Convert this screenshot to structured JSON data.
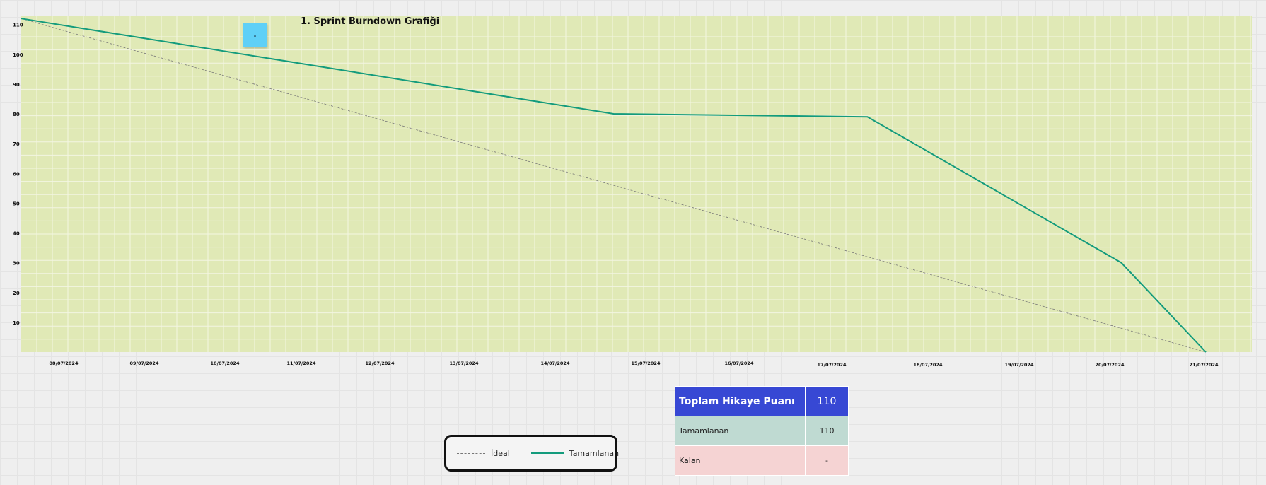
{
  "chart_data": {
    "type": "line",
    "title": "1. Sprint Burndown Grafiği",
    "x": [
      "08/07/2024",
      "09/07/2024",
      "10/07/2024",
      "11/07/2024",
      "12/07/2024",
      "13/07/2024",
      "14/07/2024",
      "15/07/2024",
      "16/07/2024",
      "17/07/2024",
      "18/07/2024",
      "19/07/2024",
      "20/07/2024",
      "21/07/2024"
    ],
    "yticks": [
      10,
      20,
      30,
      40,
      50,
      60,
      70,
      80,
      90,
      100,
      110
    ],
    "ylim": [
      0,
      113
    ],
    "grid": true,
    "series": [
      {
        "name": "İdeal",
        "style": "dashed",
        "color": "#777777",
        "points": [
          {
            "x": "07/07/2024",
            "y": 112
          },
          {
            "x": "21/07/2024",
            "y": 0
          }
        ]
      },
      {
        "name": "Tamamlanan",
        "style": "solid",
        "color": "#139b7c",
        "points": [
          {
            "x": "07/07/2024",
            "y": 112
          },
          {
            "x": "14/07/2024",
            "y": 80
          },
          {
            "x": "17/07/2024",
            "y": 79
          },
          {
            "x": "20/07/2024",
            "y": 30
          },
          {
            "x": "21/07/2024",
            "y": 0
          }
        ]
      }
    ],
    "plot_background": "#e0e9b6",
    "legend_placement": "bottom-center"
  },
  "sticky_note": {
    "text": "-",
    "color": "#5fd0f7"
  },
  "legend": {
    "ideal_label": "İdeal",
    "done_label": "Tamamlanan"
  },
  "summary_table": {
    "total_label": "Toplam Hikaye Puanı",
    "total_value": "110",
    "done_label": "Tamamlanan",
    "done_value": "110",
    "remaining_label": "Kalan",
    "remaining_value": "-"
  }
}
